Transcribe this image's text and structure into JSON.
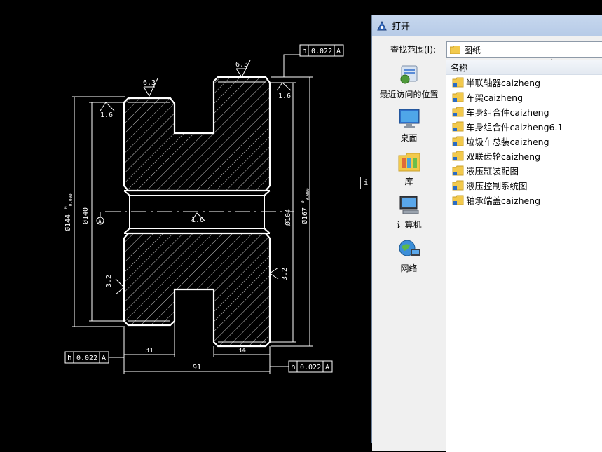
{
  "drawing": {
    "top_rough": "6.3",
    "left_rough": "6.3",
    "rough_1_6_a": "1.6",
    "rough_1_6_b": "1.6",
    "rough_1_6_c": "1.6",
    "rough_3_2_left": "3.2",
    "rough_3_2_right": "3.2",
    "dia_144": "Ø144",
    "dia_144_tol_upper": "0",
    "dia_144_tol_lower": "-0.000",
    "dia_140": "Ø140",
    "dia_104": "Ø104",
    "dia_167": "Ø167",
    "dia_167_tol_upper": "0",
    "dia_167_tol_lower": "-0.000",
    "datum_label": "A",
    "dim_31": "31",
    "dim_34": "34",
    "dim_91": "91",
    "tol_symbol": "h",
    "tol_value": "0.022",
    "tol_datum": "A",
    "tol_top_symbol": "h",
    "tol_top_value": "0.022",
    "tol_top_datum": "A",
    "gap_glyph": "i"
  },
  "dialog": {
    "title": "打开",
    "look_in_label": "查找范围(I):",
    "look_in_value": "图纸",
    "places": [
      {
        "label": "最近访问的位置",
        "icon": "recent-places-icon"
      },
      {
        "label": "桌面",
        "icon": "desktop-icon"
      },
      {
        "label": "库",
        "icon": "library-icon"
      },
      {
        "label": "计算机",
        "icon": "computer-icon"
      },
      {
        "label": "网络",
        "icon": "network-icon"
      }
    ],
    "column_header": "名称",
    "files": [
      "半联轴器caizheng",
      "车架caizheng",
      "车身组合件caizheng",
      "车身组合件caizheng6.1",
      "垃圾车总装caizheng",
      "双联齿轮caizheng",
      "液压缸装配图",
      "液压控制系统图",
      "轴承端盖caizheng"
    ]
  },
  "colors": {
    "background": "#000000",
    "line": "#ffffff",
    "folder_yellow": "#f2c94c"
  }
}
